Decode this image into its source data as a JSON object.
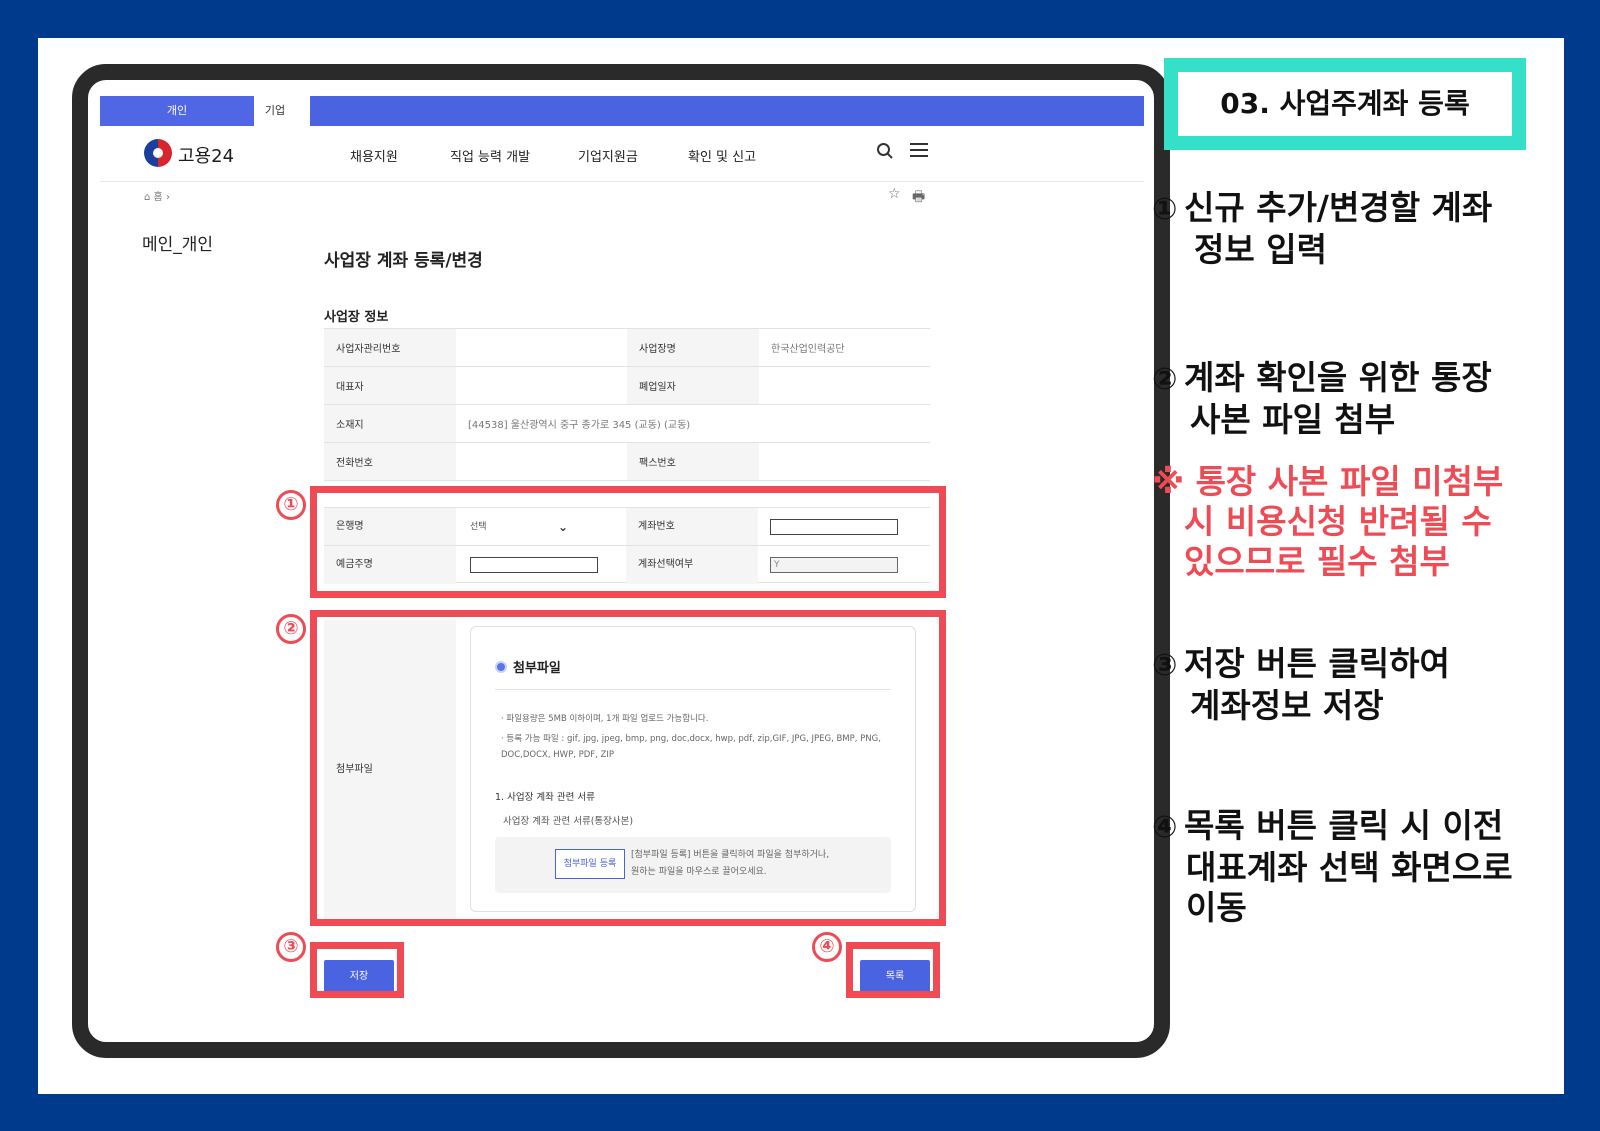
{
  "header": {
    "tab_personal": "개인",
    "tab_company": "기업",
    "logo_text": "고용24",
    "menu": [
      "채용지원",
      "직업 능력 개발",
      "기업지원금",
      "확인 및 신고"
    ]
  },
  "breadcrumb": "홈",
  "sidebar_title": "메인_개인",
  "page_title": "사업장 계좌 등록/변경",
  "section_title": "사업장 정보",
  "info_table": {
    "r1": {
      "l1": "사업자관리번호",
      "v1": "",
      "l2": "사업장명",
      "v2": "한국산업인력공단"
    },
    "r2": {
      "l1": "대표자",
      "v1": "",
      "l2": "폐업일자",
      "v2": ""
    },
    "r3": {
      "l1": "소재지",
      "v1": "[44538] 울산광역시 중구 종가로 345 (교동) (교동)"
    },
    "r4": {
      "l1": "전화번호",
      "v1": "",
      "l2": "팩스번호",
      "v2": ""
    }
  },
  "account": {
    "bank_label": "은행명",
    "bank_value": "선택",
    "account_no_label": "계좌번호",
    "account_no_value": "",
    "holder_label": "예금주명",
    "holder_value": "",
    "select_label": "계좌선택여부",
    "select_value": "Y"
  },
  "attach": {
    "label": "첨부파일",
    "heading": "첨부파일",
    "note1": "파일용량은 5MB 이하이며, 1개 파일 업로드 가능합니다.",
    "note2": "등록 가능 파일 : gif, jpg, jpeg, bmp, png, doc,docx, hwp, pdf, zip,GIF, JPG, JPEG, BMP, PNG, DOC,DOCX, HWP, PDF, ZIP",
    "section": "1. 사업장 계좌 관련 서류",
    "doc_name": "사업장 계좌 관련 서류(통장사본)",
    "upload_button": "첨부파일 등록",
    "drop_msg_1": "[첨부파일 등록] 버튼을 클릭하여 파일을 첨부하거나,",
    "drop_msg_2": "원하는 파일을 마우스로 끌어오세요."
  },
  "buttons": {
    "save": "저장",
    "list": "목록"
  },
  "markers": [
    "①",
    "②",
    "③",
    "④"
  ],
  "panel": {
    "title": "03. 사업주계좌 등록",
    "step1_a": "신규 추가/변경할 계좌",
    "step1_b": "정보 입력",
    "step2_a": "계좌 확인을 위한 통장",
    "step2_b": "사본 파일 첨부",
    "warn_a": "※ 통장 사본 파일 미첨부",
    "warn_b": "시 비용신청 반려될 수",
    "warn_c": "있으므로 필수 첨부",
    "step3_a": "저장 버튼 클릭하여",
    "step3_b": "계좌정보 저장",
    "step4_a": "목록 버튼 클릭 시 이전",
    "step4_b": "대표계좌 선택 화면으로",
    "step4_c": "이동"
  },
  "colors": {
    "background": "#003a8c",
    "accent_red": "#ef4b55",
    "title_border": "#35e0c8",
    "brand_blue": "#4a63e0"
  }
}
